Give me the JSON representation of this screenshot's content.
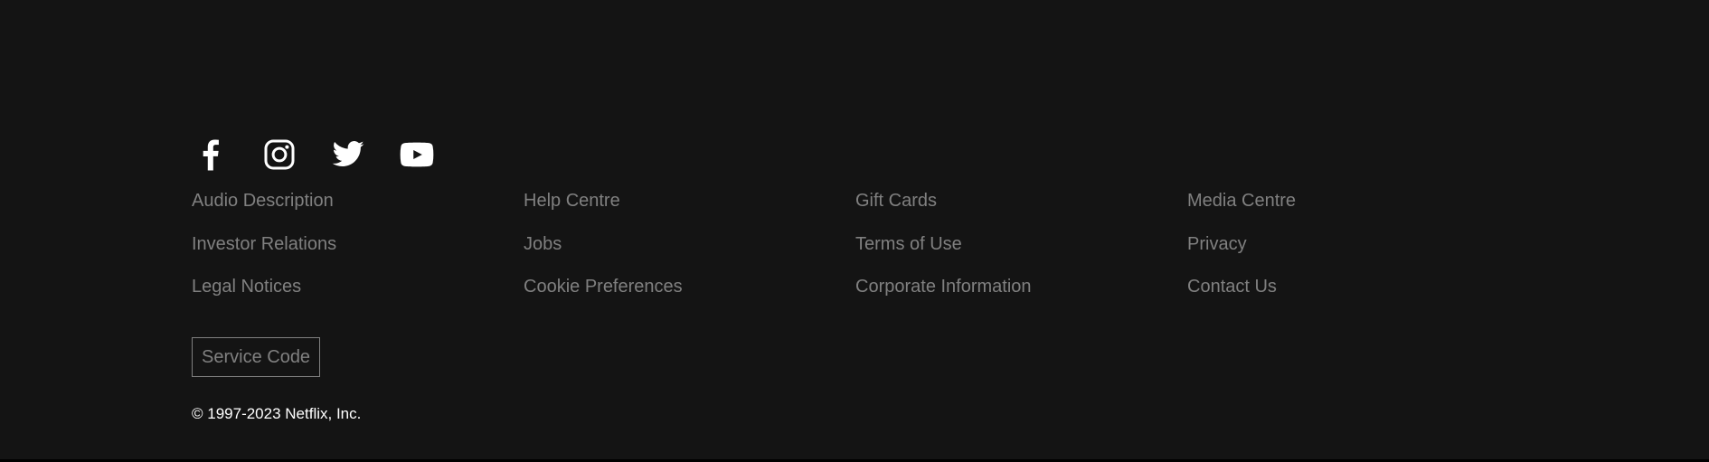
{
  "social": [
    {
      "name": "Facebook",
      "icon": "facebook-icon"
    },
    {
      "name": "Instagram",
      "icon": "instagram-icon"
    },
    {
      "name": "Twitter",
      "icon": "twitter-icon"
    },
    {
      "name": "YouTube",
      "icon": "youtube-icon"
    }
  ],
  "links": {
    "col1": [
      "Audio Description",
      "Investor Relations",
      "Legal Notices"
    ],
    "col2": [
      "Help Centre",
      "Jobs",
      "Cookie Preferences"
    ],
    "col3": [
      "Gift Cards",
      "Terms of Use",
      "Corporate Information"
    ],
    "col4": [
      "Media Centre",
      "Privacy",
      "Contact Us"
    ]
  },
  "service_code_label": "Service Code",
  "copyright": "© 1997-2023 Netflix, Inc.",
  "colors": {
    "background": "#141414",
    "link_text": "#808080",
    "icon": "#ffffff",
    "copyright_text": "#ffffff"
  }
}
